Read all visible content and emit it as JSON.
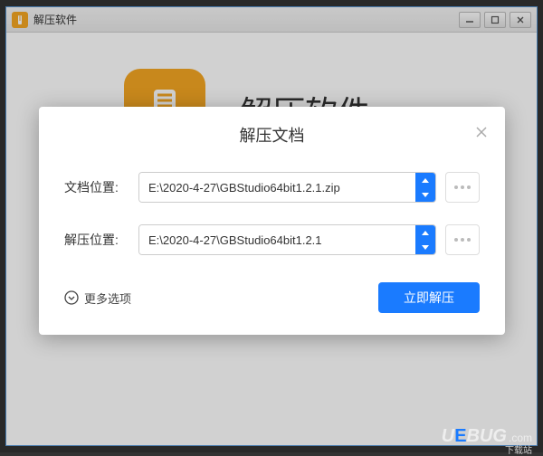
{
  "window": {
    "title": "解压软件"
  },
  "main": {
    "app_name": "解压软件"
  },
  "dialog": {
    "title": "解压文档",
    "file_label": "文档位置:",
    "file_value": "E:\\2020-4-27\\GBStudio64bit1.2.1.zip",
    "dest_label": "解压位置:",
    "dest_value": "E:\\2020-4-27\\GBStudio64bit1.2.1",
    "more_options": "更多选项",
    "extract_button": "立即解压"
  },
  "watermark": {
    "brand": "UEBUG",
    "tld": ".com",
    "sub": "下载站"
  }
}
